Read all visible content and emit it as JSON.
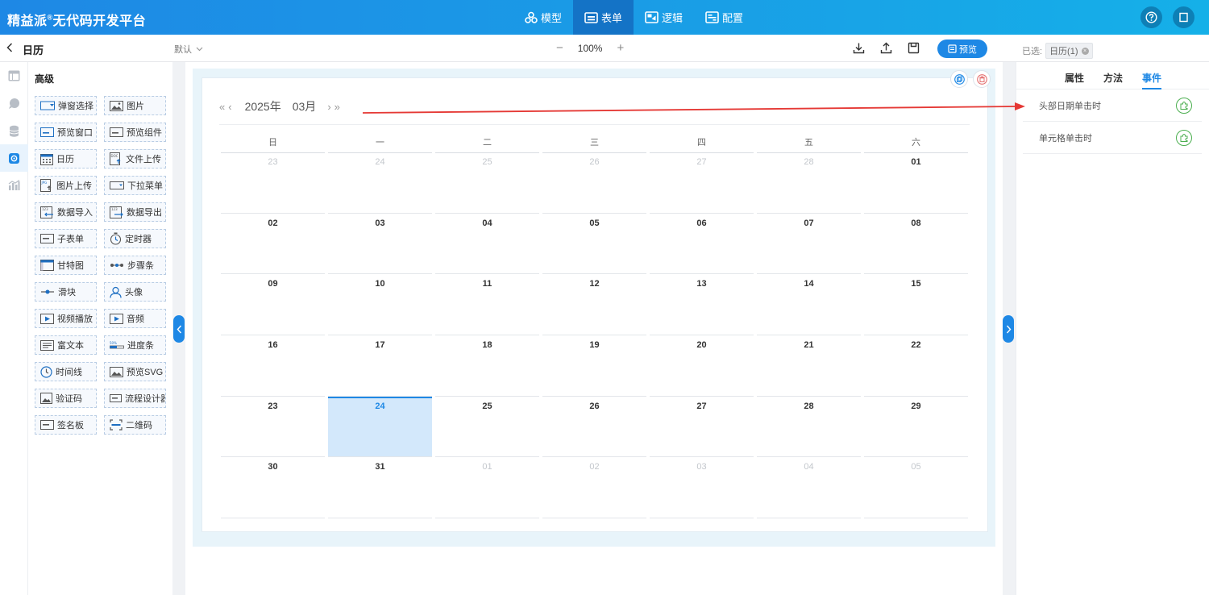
{
  "app": {
    "brand": "精益派",
    "brand_mark": "®",
    "brand_suffix": "无代码开发平台"
  },
  "nav": [
    {
      "label": "模型",
      "icon": "model-icon",
      "active": false
    },
    {
      "label": "表单",
      "icon": "form-icon",
      "active": true
    },
    {
      "label": "逻辑",
      "icon": "logic-icon",
      "active": false
    },
    {
      "label": "配置",
      "icon": "config-icon",
      "active": false
    }
  ],
  "toolbar": {
    "page_name": "日历",
    "theme": "默认",
    "zoom": "100%",
    "preview_label": "预览",
    "selected_label": "已选:",
    "selected_value": "日历(1)"
  },
  "components": {
    "title": "高级",
    "items": [
      "弹窗选择",
      "图片",
      "预览窗口",
      "预览组件",
      "日历",
      "文件上传",
      "图片上传",
      "下拉菜单",
      "数据导入",
      "数据导出",
      "子表单",
      "定时器",
      "甘特图",
      "步骤条",
      "滑块",
      "头像",
      "视频播放",
      "音频",
      "富文本",
      "进度条",
      "时间线",
      "预览SVG",
      "验证码",
      "流程设计器",
      "签名板",
      "二维码"
    ]
  },
  "calendar": {
    "prev_year": "«",
    "prev_month": "‹",
    "year": "2025年",
    "month": "03月",
    "next_month": "›",
    "next_year": "»",
    "weekdays": [
      "日",
      "一",
      "二",
      "三",
      "四",
      "五",
      "六"
    ],
    "days": [
      {
        "d": "23",
        "other": true
      },
      {
        "d": "24",
        "other": true
      },
      {
        "d": "25",
        "other": true
      },
      {
        "d": "26",
        "other": true
      },
      {
        "d": "27",
        "other": true
      },
      {
        "d": "28",
        "other": true
      },
      {
        "d": "01"
      },
      {
        "d": "02"
      },
      {
        "d": "03"
      },
      {
        "d": "04"
      },
      {
        "d": "05"
      },
      {
        "d": "06"
      },
      {
        "d": "07"
      },
      {
        "d": "08"
      },
      {
        "d": "09"
      },
      {
        "d": "10"
      },
      {
        "d": "11"
      },
      {
        "d": "12"
      },
      {
        "d": "13"
      },
      {
        "d": "14"
      },
      {
        "d": "15"
      },
      {
        "d": "16"
      },
      {
        "d": "17"
      },
      {
        "d": "18"
      },
      {
        "d": "19"
      },
      {
        "d": "20"
      },
      {
        "d": "21"
      },
      {
        "d": "22"
      },
      {
        "d": "23"
      },
      {
        "d": "24",
        "today": true
      },
      {
        "d": "25"
      },
      {
        "d": "26"
      },
      {
        "d": "27"
      },
      {
        "d": "28"
      },
      {
        "d": "29"
      },
      {
        "d": "30"
      },
      {
        "d": "31"
      },
      {
        "d": "01",
        "other": true
      },
      {
        "d": "02",
        "other": true
      },
      {
        "d": "03",
        "other": true
      },
      {
        "d": "04",
        "other": true
      },
      {
        "d": "05",
        "other": true
      }
    ]
  },
  "right_panel": {
    "tabs": [
      {
        "label": "属性",
        "active": false
      },
      {
        "label": "方法",
        "active": false
      },
      {
        "label": "事件",
        "active": true
      }
    ],
    "events": [
      "头部日期单击时",
      "单元格单击时"
    ]
  },
  "colors": {
    "accent": "#1e88e5",
    "today_bg": "#d3e8fb",
    "annotation_arrow": "#e53935",
    "event_icon": "#4caf50"
  }
}
